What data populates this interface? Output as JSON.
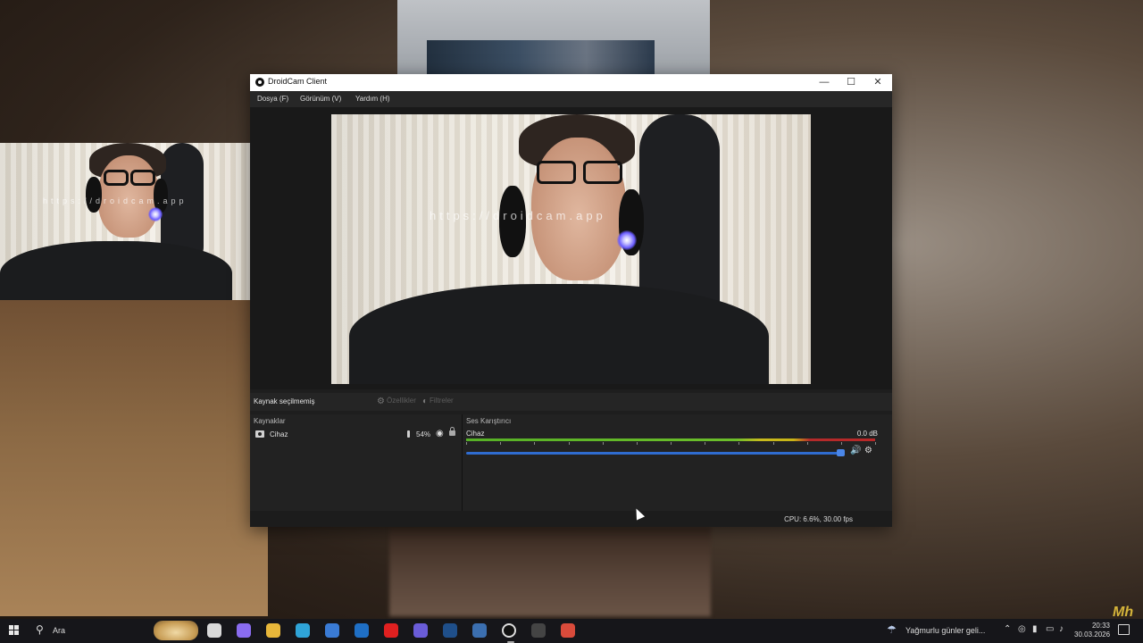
{
  "window": {
    "title": "DroidCam Client",
    "controls": {
      "minimize": "—",
      "maximize": "☐",
      "close": "✕"
    }
  },
  "menubar": {
    "items": [
      {
        "label": "Dosya (F)"
      },
      {
        "label": "Görünüm (V)"
      },
      {
        "label": "Yardım (H)"
      }
    ]
  },
  "preview": {
    "watermark": "https://droidcam.app"
  },
  "source_bar": {
    "no_source": "Kaynak seçilmemiş",
    "properties": "Özellikler",
    "filters": "Filtreler"
  },
  "sources_panel": {
    "heading": "Kaynaklar",
    "items": [
      {
        "name": "Cihaz",
        "level": "54%"
      }
    ]
  },
  "mixer_panel": {
    "heading": "Ses Karıştırıcı",
    "device": "Cihaz",
    "db": "0.0 dB",
    "volume_fraction": 0.93,
    "tick_labels": [
      "-60",
      "-55",
      "-50",
      "-45",
      "-40",
      "-35",
      "-30",
      "-25",
      "-20",
      "-15",
      "-10",
      "-5",
      "0"
    ]
  },
  "statusbar": {
    "cpu": "CPU: 6.6%, 30.00 fps"
  },
  "taskbar": {
    "search_label": "Ara",
    "weather": "Yağmurlu günler geli...",
    "clock_time": "20:33",
    "clock_date": "30.03.2026",
    "apps": [
      {
        "icon": "task-view-icon",
        "color": "#d9d9d9"
      },
      {
        "icon": "copilot-icon",
        "color": "#8a6cf0"
      },
      {
        "icon": "file-explorer-icon",
        "color": "#e8b73a"
      },
      {
        "icon": "edge-icon",
        "color": "#2fa4d8"
      },
      {
        "icon": "store-icon",
        "color": "#3a7bd5"
      },
      {
        "icon": "outlook-icon",
        "color": "#1f6fc5"
      },
      {
        "icon": "youtube-icon",
        "color": "#e02020"
      },
      {
        "icon": "discord-icon",
        "color": "#6a5cd8"
      },
      {
        "icon": "steam-icon",
        "color": "#1f4f8a"
      },
      {
        "icon": "app-icon",
        "color": "#3b6fb0"
      },
      {
        "icon": "droidcam-icon",
        "color": "#dddddd"
      },
      {
        "icon": "obs-icon",
        "color": "#444444"
      },
      {
        "icon": "chrome-icon",
        "color": "#d94b3b"
      }
    ]
  },
  "overlay": {
    "corner_logo": "Mh"
  }
}
